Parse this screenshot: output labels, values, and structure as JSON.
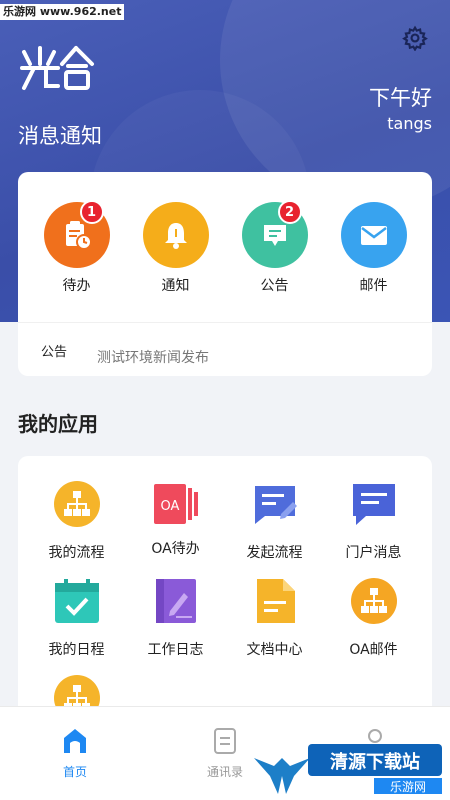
{
  "watermark": "乐游网 www.962.net",
  "header": {
    "logo_text": "光合",
    "title": "消息通知",
    "greeting": "下午好",
    "username": "tangs"
  },
  "quick": [
    {
      "label": "待办",
      "badge": "1",
      "color": "#f0701c",
      "icon": "todo-icon"
    },
    {
      "label": "通知",
      "badge": "",
      "color": "#f5ad1a",
      "icon": "bell-icon"
    },
    {
      "label": "公告",
      "badge": "2",
      "color": "#3fc1a0",
      "icon": "announcement-icon"
    },
    {
      "label": "邮件",
      "badge": "",
      "color": "#38a3ef",
      "icon": "mail-icon"
    }
  ],
  "notice": {
    "tag": "公告",
    "text": "测试环境新闻发布"
  },
  "apps_section": {
    "title": "我的应用"
  },
  "apps": [
    {
      "label": "我的流程",
      "icon": "flow-icon",
      "color": "#f5b42a"
    },
    {
      "label": "OA待办",
      "icon": "oa-todo-icon",
      "color": "#ef4a5c",
      "icon_text": "OA"
    },
    {
      "label": "发起流程",
      "icon": "start-flow-icon",
      "color": "#4f6cdb"
    },
    {
      "label": "门户消息",
      "icon": "portal-message-icon",
      "color": "#4a63d8"
    },
    {
      "label": "我的日程",
      "icon": "calendar-icon",
      "color": "#2ec7b8"
    },
    {
      "label": "工作日志",
      "icon": "work-log-icon",
      "color": "#8a5ad8"
    },
    {
      "label": "文档中心",
      "icon": "document-icon",
      "color": "#f5b42a"
    },
    {
      "label": "OA邮件",
      "icon": "oa-mail-icon",
      "color": "#f5a623"
    }
  ],
  "tabbar": [
    {
      "label": "首页",
      "icon": "home-icon",
      "active": true
    },
    {
      "label": "通讯录",
      "icon": "contacts-icon",
      "active": false
    },
    {
      "label": "",
      "icon": "profile-icon",
      "active": false
    }
  ],
  "overlay_brand": {
    "text": "清源下载站",
    "sub": "乐游网"
  }
}
